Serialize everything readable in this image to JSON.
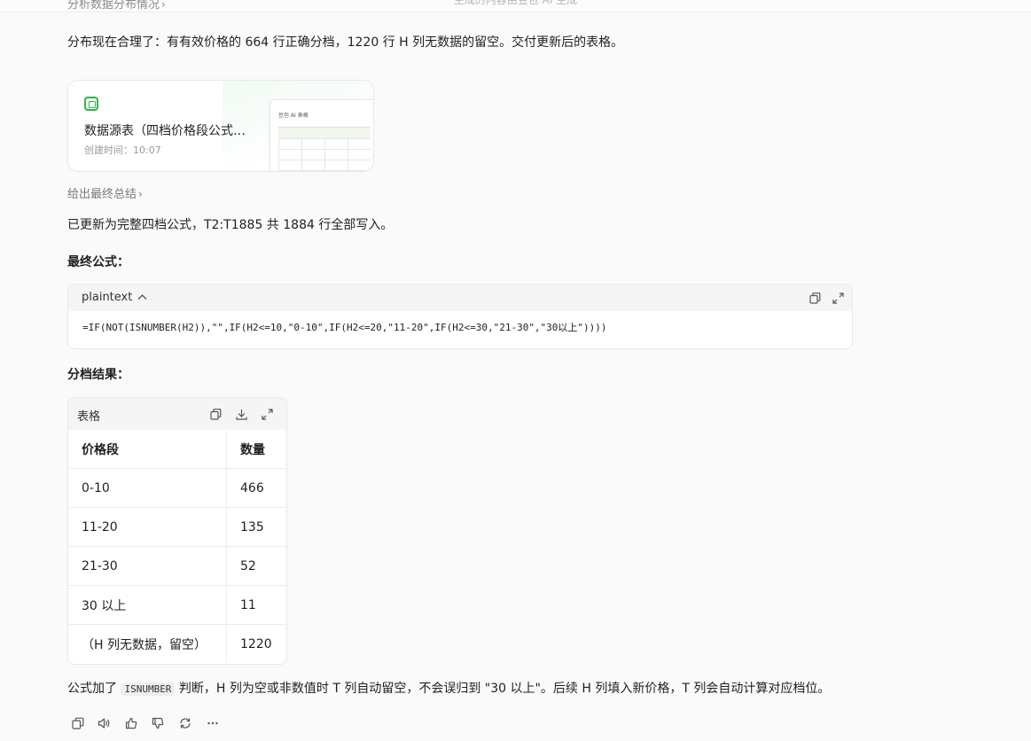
{
  "window": {
    "title": "生成的内容由豆包 AI 生成"
  },
  "prev_step": {
    "label": "分析数据分布情况"
  },
  "intro": {
    "text": "分布现在合理了：有有效价格的 664 行正确分档，1220 行 H 列无数据的留空。交付更新后的表格。"
  },
  "doc_card": {
    "name": "数据源表（四档价格段公式已更新）",
    "created": "创建时间：10:07",
    "thumb_title": "豆包 AI 表格"
  },
  "summary_step": {
    "label": "给出最终总结"
  },
  "update_text": {
    "text": "已更新为完整四档公式，T2:T1885 共 1884 行全部写入。"
  },
  "formula_heading": {
    "text": "最终公式："
  },
  "code_block": {
    "lang": "plaintext",
    "code": "=IF(NOT(ISNUMBER(H2)),\"\",IF(H2<=10,\"0-10\",IF(H2<=20,\"11-20\",IF(H2<=30,\"21-30\",\"30以上\"))))"
  },
  "result_heading": {
    "text": "分档结果："
  },
  "table": {
    "title": "表格",
    "columns": [
      "价格段",
      "数量"
    ],
    "rows": [
      [
        "0-10",
        "466"
      ],
      [
        "11-20",
        "135"
      ],
      [
        "21-30",
        "52"
      ],
      [
        "30 以上",
        "11"
      ],
      [
        "（H 列无数据，留空）",
        "1220"
      ]
    ]
  },
  "footer_text": {
    "before": "公式加了 ",
    "code": "ISNUMBER",
    "after": " 判断，H 列为空或非数值时 T 列自动留空，不会误归到 \"30 以上\"。后续 H 列填入新价格，T 列会自动计算对应档位。"
  },
  "icons": [
    "copy-icon",
    "expand-icon",
    "download-icon",
    "speaker-icon",
    "thumbs-up-icon",
    "thumbs-down-icon",
    "refresh-icon",
    "more-icon"
  ]
}
